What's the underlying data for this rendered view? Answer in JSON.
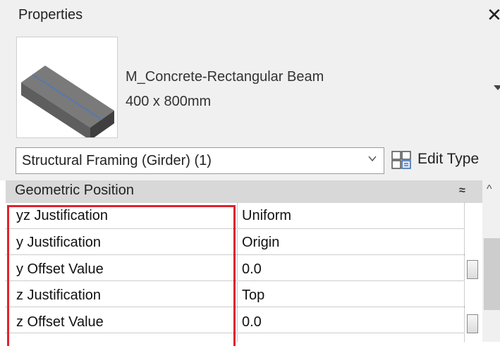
{
  "window": {
    "title": "Properties",
    "close_glyph": "✕"
  },
  "type_selector": {
    "family_name": "M_Concrete-Rectangular Beam",
    "type_name": "400 x 800mm",
    "thumbnail_icon": "concrete-beam-thumbnail"
  },
  "filter": {
    "selected": "Structural Framing (Girder) (1)",
    "edit_type_label": "Edit Type"
  },
  "group": {
    "title": "Geometric Position",
    "collapse_glyph": "≈"
  },
  "properties": [
    {
      "name": "yz Justification",
      "value": "Uniform",
      "has_button": false
    },
    {
      "name": "y Justification",
      "value": "Origin",
      "has_button": false
    },
    {
      "name": "y Offset Value",
      "value": "0.0",
      "has_button": true
    },
    {
      "name": "z Justification",
      "value": "Top",
      "has_button": false
    },
    {
      "name": "z Offset Value",
      "value": "0.0",
      "has_button": true
    }
  ],
  "scrollbar": {
    "up_glyph": "^"
  },
  "colors": {
    "highlight": "#e0212b",
    "panel_bg": "#f0f0f0",
    "group_header": "#d8d8d8"
  }
}
